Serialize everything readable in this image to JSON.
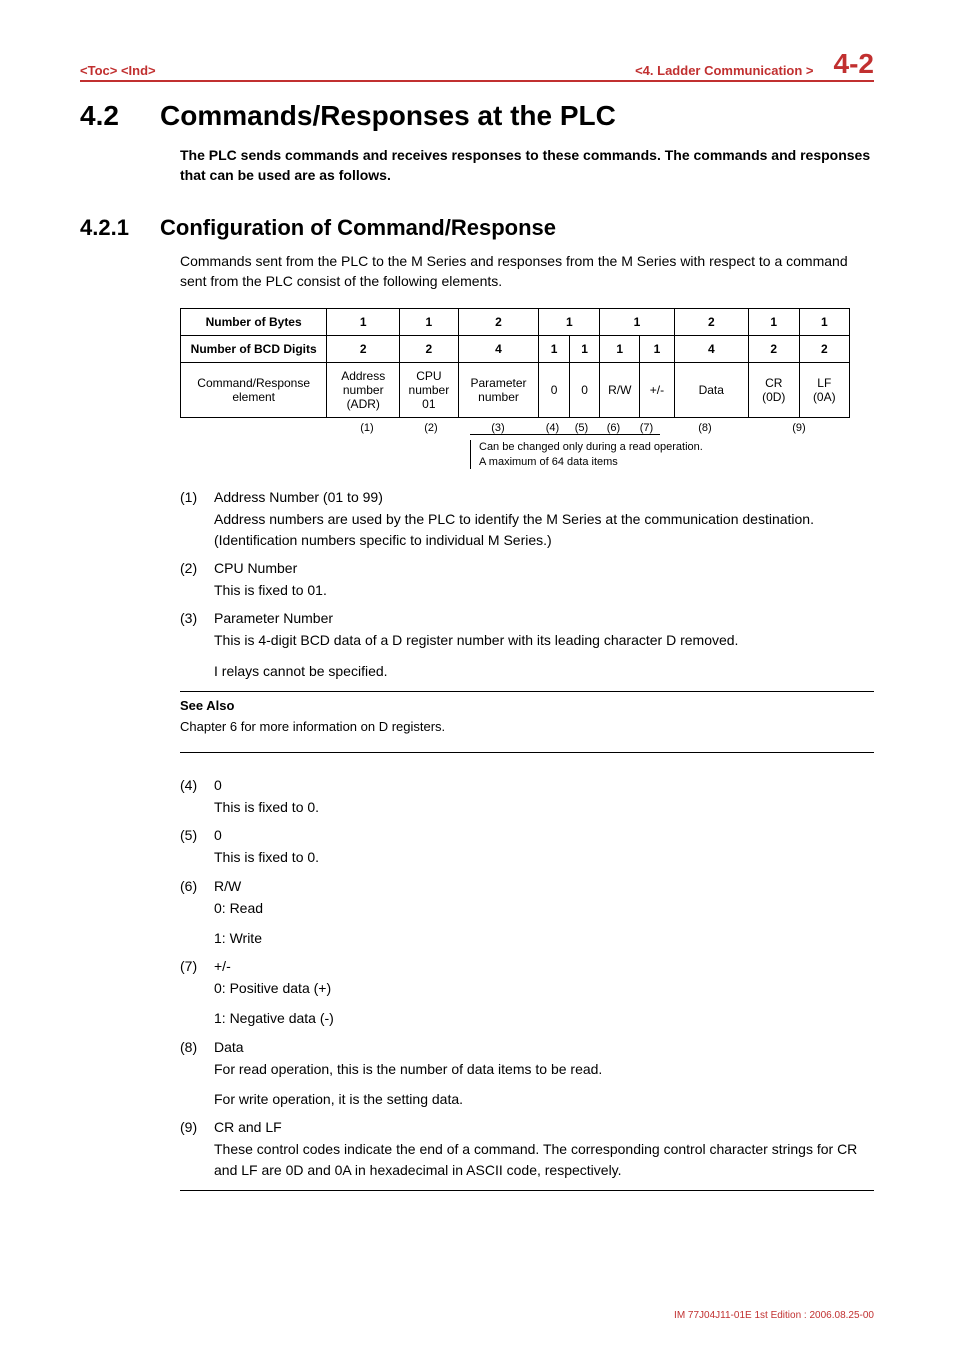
{
  "header": {
    "left": "<Toc> <Ind>",
    "center": "<4.  Ladder Communication >",
    "page": "4-2"
  },
  "section": {
    "number": "4.2",
    "title": "Commands/Responses at the PLC",
    "intro": "The PLC sends commands and receives responses to these commands. The commands and responses that can be used are as follows."
  },
  "subsection": {
    "number": "4.2.1",
    "title": "Configuration of Command/Response",
    "intro": "Commands sent from the PLC to the M Series and responses from the M Series with respect to a command sent from the PLC consist of the following elements."
  },
  "table": {
    "rows": [
      {
        "label": "Number of Bytes",
        "cells": [
          "1",
          "1",
          "2",
          "1",
          "1",
          "2",
          "1",
          "1"
        ]
      },
      {
        "label": "Number of BCD Digits",
        "cells": [
          "2",
          "2",
          "4",
          "1",
          "1",
          "1",
          "1",
          "4",
          "2",
          "2"
        ]
      },
      {
        "label": "Command/Response element",
        "cells": [
          "Address number (ADR)",
          "CPU number 01",
          "Parameter number",
          "0",
          "0",
          "R/W",
          "+/-",
          "Data",
          "CR\n(0D)",
          "LF\n(0A)"
        ]
      }
    ],
    "footnums": [
      "(1)",
      "(2)",
      "(3)",
      "(4)",
      "(5)",
      "(6)",
      "(7)",
      "(8)",
      "(9)"
    ],
    "note_line1": "Can be changed only during a read operation.",
    "note_line2": "A maximum of 64 data items"
  },
  "items": [
    {
      "n": "(1)",
      "title": "Address Number (01 to 99)",
      "body": [
        "Address numbers are used by the PLC to identify the M Series at the communication destination. (Identification numbers specific to individual M Series.)"
      ]
    },
    {
      "n": "(2)",
      "title": "CPU Number",
      "body": [
        "This is fixed to 01."
      ]
    },
    {
      "n": "(3)",
      "title": "Parameter Number",
      "body": [
        "This is 4-digit BCD data of a D register number with its leading character D removed.",
        " I relays cannot be specified."
      ]
    }
  ],
  "see_also": {
    "heading": "See Also",
    "body": "Chapter 6 for more information on D registers."
  },
  "items2": [
    {
      "n": "(4)",
      "title": "0",
      "body": [
        "This is fixed to 0."
      ]
    },
    {
      "n": "(5)",
      "title": "0",
      "body": [
        "This is fixed to 0."
      ]
    },
    {
      "n": "(6)",
      "title": "R/W",
      "body": [
        "0: Read",
        "1: Write"
      ]
    },
    {
      "n": "(7)",
      "title": "+/-",
      "body": [
        "0: Positive data (+)",
        "1: Negative data (-)"
      ]
    },
    {
      "n": "(8)",
      "title": "Data",
      "body": [
        "For read operation, this is the number of data items to be read.",
        "For write operation, it is the setting data."
      ]
    },
    {
      "n": "(9)",
      "title": "CR and LF",
      "body": [
        "These control codes indicate the end of a command. The corresponding control character strings for CR and LF are 0D and 0A in hexadecimal in ASCII code, respectively."
      ]
    }
  ],
  "footer": "IM 77J04J11-01E  1st Edition : 2006.08.25-00"
}
